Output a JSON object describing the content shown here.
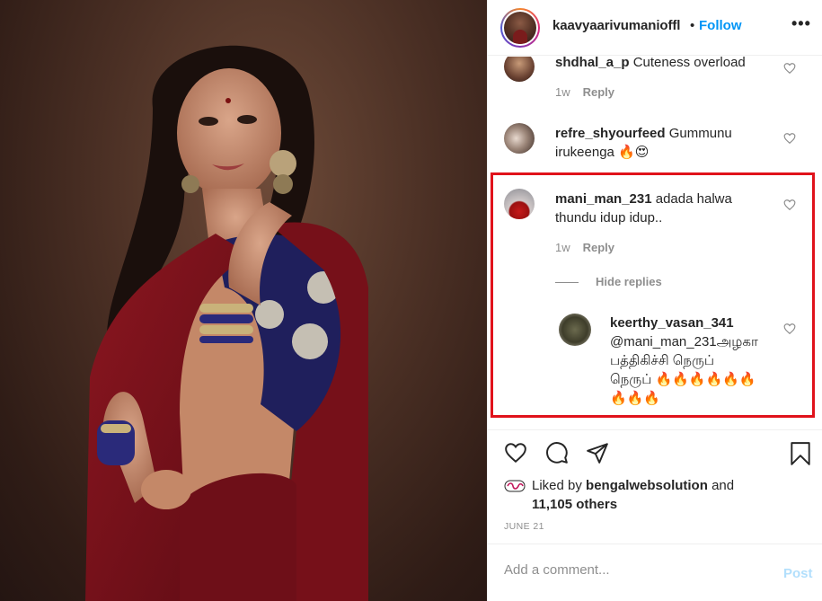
{
  "post": {
    "author": "kaavyaarivumanioffl",
    "follow_label": "Follow",
    "dot": "•",
    "more_label": "•••"
  },
  "comments": [
    {
      "username": "shdhal_a_p",
      "text": "Cuteness overload",
      "time": "1w",
      "reply_label": "Reply"
    },
    {
      "username": "refre_shyourfeed",
      "text": "Gummunu irukeenga 🔥😍",
      "text_line1": "Gummunu",
      "text_line2": "irukeenga 🔥😍"
    },
    {
      "username": "mani_man_231",
      "text_line1": "adada halwa",
      "text_line2": "thundu idup idup..",
      "time": "1w",
      "reply_label": "Reply",
      "hide_replies": "Hide replies",
      "replies": [
        {
          "username": "keerthy_vasan_341",
          "mention": "@mani_man_231",
          "text_line1": "அழகா",
          "text_line2": "பத்திகிச்சி நெருப்",
          "text_line3": "நெருப் 🔥🔥🔥🔥🔥🔥",
          "text_line4": "🔥🔥🔥"
        }
      ]
    }
  ],
  "likes": {
    "prefix": "Liked by",
    "user": "bengalwebsolution",
    "and": "and",
    "others": "11,105 others"
  },
  "date": "JUNE 21",
  "add_comment": {
    "placeholder": "Add a comment...",
    "post_label": "Post"
  },
  "icons": [
    "heart-icon",
    "comment-icon",
    "share-icon",
    "bookmark-icon",
    "more-options-icon"
  ],
  "colors": {
    "accent": "#0095f6",
    "highlight": "#e0121b",
    "muted": "#8e8e8e",
    "post_disabled": "#b2dffc"
  }
}
